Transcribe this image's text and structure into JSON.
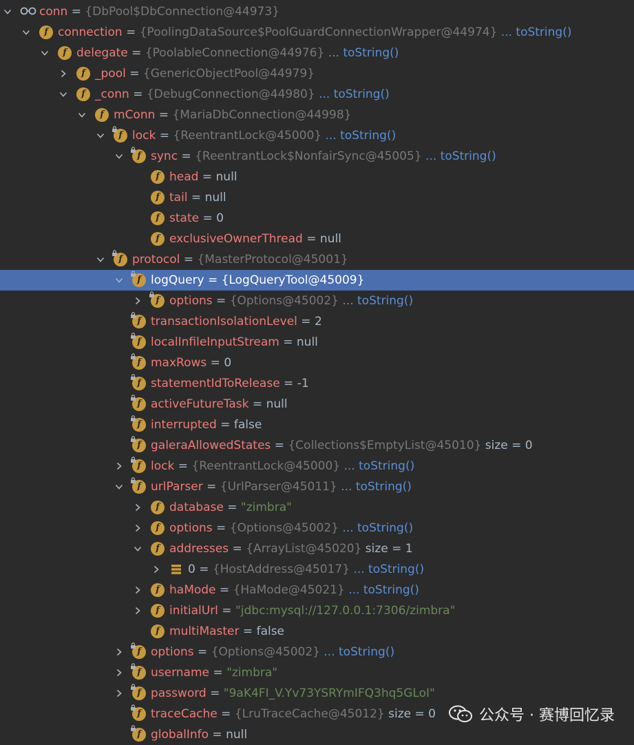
{
  "colors": {
    "background": "#2b2b2b",
    "selection": "#4b6eaf",
    "field_name": "#ef7a7a",
    "object_value": "#787878",
    "string_value": "#6a8759",
    "link": "#5a8fd6",
    "field_icon": "#c79a3e"
  },
  "rows": [
    {
      "name": "conn",
      "eq": " = ",
      "val": "{DbPool$DbConnection@44973}",
      "vtype": "obj",
      "depth": 0,
      "arrow": "down",
      "icon": "glasses"
    },
    {
      "name": "connection",
      "eq": " = ",
      "val": "{PoolingDataSource$PoolGuardConnectionWrapper@44974}",
      "vtype": "obj",
      "tostr": "... toString()",
      "depth": 1,
      "arrow": "down",
      "icon": "field"
    },
    {
      "name": "delegate",
      "eq": " = ",
      "val": "{PoolableConnection@44976}",
      "vtype": "obj",
      "tostr": "... toString()",
      "depth": 2,
      "arrow": "down",
      "icon": "field"
    },
    {
      "name": "_pool",
      "eq": " = ",
      "val": "{GenericObjectPool@44979}",
      "vtype": "obj",
      "depth": 3,
      "arrow": "right",
      "icon": "field"
    },
    {
      "name": "_conn",
      "eq": " = ",
      "val": "{DebugConnection@44980}",
      "vtype": "obj",
      "tostr": "... toString()",
      "depth": 3,
      "arrow": "down",
      "icon": "field"
    },
    {
      "name": "mConn",
      "eq": " = ",
      "val": "{MariaDbConnection@44998}",
      "vtype": "obj",
      "depth": 4,
      "arrow": "down",
      "icon": "field"
    },
    {
      "name": "lock",
      "eq": " = ",
      "val": "{ReentrantLock@45000}",
      "vtype": "obj",
      "tostr": "... toString()",
      "depth": 5,
      "arrow": "down",
      "icon": "field-lock"
    },
    {
      "name": "sync",
      "eq": " = ",
      "val": "{ReentrantLock$NonfairSync@45005}",
      "vtype": "obj",
      "tostr": "... toString()",
      "depth": 6,
      "arrow": "down",
      "icon": "field-lock"
    },
    {
      "name": "head",
      "eq": " = ",
      "val": "null",
      "vtype": "plain",
      "depth": 7,
      "arrow": "none",
      "icon": "field"
    },
    {
      "name": "tail",
      "eq": " = ",
      "val": "null",
      "vtype": "plain",
      "depth": 7,
      "arrow": "none",
      "icon": "field"
    },
    {
      "name": "state",
      "eq": " = ",
      "val": "0",
      "vtype": "plain",
      "depth": 7,
      "arrow": "none",
      "icon": "field"
    },
    {
      "name": "exclusiveOwnerThread",
      "eq": " = ",
      "val": "null",
      "vtype": "plain",
      "depth": 7,
      "arrow": "none",
      "icon": "field"
    },
    {
      "name": "protocol",
      "eq": " = ",
      "val": "{MasterProtocol@45001}",
      "vtype": "obj",
      "depth": 5,
      "arrow": "down",
      "icon": "field-lock"
    },
    {
      "name": "logQuery",
      "eq": " = ",
      "val": "{LogQueryTool@45009}",
      "vtype": "obj",
      "depth": 6,
      "arrow": "down",
      "icon": "field-lock",
      "selected": true
    },
    {
      "name": "options",
      "eq": " = ",
      "val": "{Options@45002}",
      "vtype": "obj",
      "tostr": "... toString()",
      "depth": 7,
      "arrow": "right",
      "icon": "field-lock"
    },
    {
      "name": "transactionIsolationLevel",
      "eq": " = ",
      "val": "2",
      "vtype": "plain",
      "depth": 6,
      "arrow": "none",
      "icon": "field-lock"
    },
    {
      "name": "localInfileInputStream",
      "eq": " = ",
      "val": "null",
      "vtype": "plain",
      "depth": 6,
      "arrow": "none",
      "icon": "field-lock"
    },
    {
      "name": "maxRows",
      "eq": " = ",
      "val": "0",
      "vtype": "plain",
      "depth": 6,
      "arrow": "none",
      "icon": "field-lock"
    },
    {
      "name": "statementIdToRelease",
      "eq": " = ",
      "val": "-1",
      "vtype": "plain",
      "depth": 6,
      "arrow": "none",
      "icon": "field-lock"
    },
    {
      "name": "activeFutureTask",
      "eq": " = ",
      "val": "null",
      "vtype": "plain",
      "depth": 6,
      "arrow": "none",
      "icon": "field-lock"
    },
    {
      "name": "interrupted",
      "eq": " = ",
      "val": "false",
      "vtype": "plain",
      "depth": 6,
      "arrow": "none",
      "icon": "field-lock"
    },
    {
      "name": "galeraAllowedStates",
      "eq": " = ",
      "val": "{Collections$EmptyList@45010}",
      "vtype": "obj",
      "size": "size = 0",
      "depth": 6,
      "arrow": "none",
      "icon": "field-lock"
    },
    {
      "name": "lock",
      "eq": " = ",
      "val": "{ReentrantLock@45000}",
      "vtype": "obj",
      "tostr": "... toString()",
      "depth": 6,
      "arrow": "right",
      "icon": "field-lock"
    },
    {
      "name": "urlParser",
      "eq": " = ",
      "val": "{UrlParser@45011}",
      "vtype": "obj",
      "tostr": "... toString()",
      "depth": 6,
      "arrow": "down",
      "icon": "field-lock"
    },
    {
      "name": "database",
      "eq": " = ",
      "val": "\"zimbra\"",
      "vtype": "str",
      "depth": 7,
      "arrow": "right",
      "icon": "field"
    },
    {
      "name": "options",
      "eq": " = ",
      "val": "{Options@45002}",
      "vtype": "obj",
      "tostr": "... toString()",
      "depth": 7,
      "arrow": "right",
      "icon": "field"
    },
    {
      "name": "addresses",
      "eq": " = ",
      "val": "{ArrayList@45020}",
      "vtype": "obj",
      "size": "size = 1",
      "depth": 7,
      "arrow": "down",
      "icon": "field"
    },
    {
      "name": "0",
      "eq": " = ",
      "val": "{HostAddress@45017}",
      "vtype": "obj",
      "tostr": "... toString()",
      "depth": 8,
      "arrow": "right",
      "icon": "array",
      "plainname": true
    },
    {
      "name": "haMode",
      "eq": " = ",
      "val": "{HaMode@45021}",
      "vtype": "obj",
      "tostr": "... toString()",
      "depth": 7,
      "arrow": "right",
      "icon": "field"
    },
    {
      "name": "initialUrl",
      "eq": " = ",
      "val": "\"jdbc:mysql://127.0.0.1:7306/zimbra\"",
      "vtype": "str",
      "depth": 7,
      "arrow": "right",
      "icon": "field"
    },
    {
      "name": "multiMaster",
      "eq": " = ",
      "val": "false",
      "vtype": "plain",
      "depth": 7,
      "arrow": "none",
      "icon": "field"
    },
    {
      "name": "options",
      "eq": " = ",
      "val": "{Options@45002}",
      "vtype": "obj",
      "tostr": "... toString()",
      "depth": 6,
      "arrow": "right",
      "icon": "field-lock"
    },
    {
      "name": "username",
      "eq": " = ",
      "val": "\"zimbra\"",
      "vtype": "str",
      "depth": 6,
      "arrow": "right",
      "icon": "field-lock"
    },
    {
      "name": "password",
      "eq": " = ",
      "val": "\"9aK4FI_V.Yv73YSRYmIFQ3hq5GLoI\"",
      "vtype": "str",
      "depth": 6,
      "arrow": "right",
      "icon": "field-lock"
    },
    {
      "name": "traceCache",
      "eq": " = ",
      "val": "{LruTraceCache@45012}",
      "vtype": "obj",
      "size": "size = 0",
      "depth": 6,
      "arrow": "none",
      "icon": "field-lock"
    },
    {
      "name": "globalInfo",
      "eq": " = ",
      "val": "null",
      "vtype": "plain",
      "depth": 6,
      "arrow": "none",
      "icon": "field-lock"
    }
  ],
  "watermark": {
    "text": "公众号 · 赛博回忆录",
    "icon": "wechat-icon"
  }
}
